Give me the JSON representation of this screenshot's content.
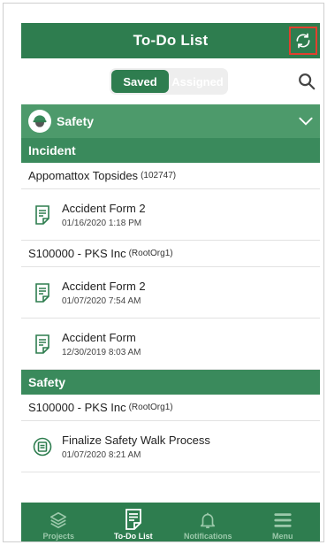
{
  "header": {
    "title": "To-Do List",
    "refresh_icon": "refresh-icon"
  },
  "toggle": {
    "saved_label": "Saved",
    "assigned_label": "Assigned"
  },
  "module": {
    "title": "Safety",
    "icon": "hardhat-icon"
  },
  "sections": [
    {
      "title": "Incident",
      "groups": [
        {
          "name": "Appomattox Topsides",
          "org": "(102747)",
          "items": [
            {
              "name": "Accident Form 2",
              "date": "01/16/2020 1:18 PM"
            }
          ]
        },
        {
          "name": "S100000 - PKS Inc",
          "org": "(RootOrg1)",
          "items": [
            {
              "name": "Accident Form 2",
              "date": "01/07/2020 7:54 AM"
            },
            {
              "name": "Accident Form",
              "date": "12/30/2019 8:03 AM"
            }
          ]
        }
      ]
    },
    {
      "title": "Safety",
      "groups": [
        {
          "name": "S100000 - PKS Inc",
          "org": "(RootOrg1)",
          "items": [
            {
              "name": "Finalize Safety Walk Process",
              "date": "01/07/2020 8:21 AM"
            }
          ]
        }
      ]
    }
  ],
  "tabs": [
    {
      "label": "Projects",
      "icon": "layers-icon"
    },
    {
      "label": "To-Do List",
      "icon": "todo-list-icon",
      "active": true
    },
    {
      "label": "Notifications",
      "icon": "bell-icon"
    },
    {
      "label": "Menu",
      "icon": "menu-icon"
    }
  ],
  "colors": {
    "primary": "#2e7d4f",
    "module": "#4d9a6b",
    "section": "#3a8a5c",
    "highlight": "#e0402e"
  }
}
